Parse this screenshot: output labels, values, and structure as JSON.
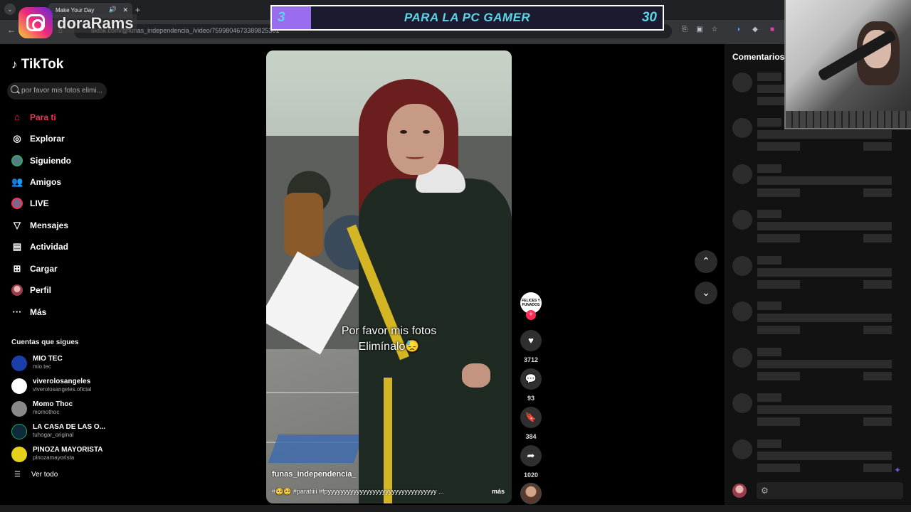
{
  "browser": {
    "tab_title": "Make Your Day",
    "url": "tiktok.com/@funas_independencia_/video/7599804673389825301"
  },
  "overlay": {
    "instagram_handle": "doraRams",
    "goal": {
      "current": "3",
      "label": "PARA LA PC GAMER",
      "target": "30",
      "progress": 0.1
    }
  },
  "tiktok": {
    "logo": "TikTok",
    "search_placeholder": "por favor mis fotos elimi...",
    "nav": [
      {
        "label": "Para ti",
        "icon": "home-icon"
      },
      {
        "label": "Explorar",
        "icon": "compass-icon"
      },
      {
        "label": "Siguiendo",
        "icon": "following-icon"
      },
      {
        "label": "Amigos",
        "icon": "friends-icon"
      },
      {
        "label": "LIVE",
        "icon": "live-icon"
      },
      {
        "label": "Mensajes",
        "icon": "messages-icon"
      },
      {
        "label": "Actividad",
        "icon": "activity-icon"
      },
      {
        "label": "Cargar",
        "icon": "upload-icon"
      },
      {
        "label": "Perfil",
        "icon": "profile-icon"
      },
      {
        "label": "Más",
        "icon": "more-icon"
      }
    ],
    "following_title": "Cuentas que sigues",
    "following": [
      {
        "name": "MIO TEC",
        "handle": "mio.tec",
        "color": "#1a3fa8"
      },
      {
        "name": "viverolosangeles",
        "handle": "viverolosangeles.oficial",
        "color": "#ffffff"
      },
      {
        "name": "Momo Thoc",
        "handle": "momothoc",
        "color": "#888888"
      },
      {
        "name": "LA CASA DE LAS O...",
        "handle": "tuhogar_original",
        "color": "#0e2a3a"
      },
      {
        "name": "PINOZA MAYORISTA",
        "handle": "pinozamayorista",
        "color": "#e5d11c"
      }
    ],
    "see_all": "Ver todo",
    "video": {
      "caption_line1": "Por favor mis fotos",
      "caption_line2": "Elimínalo😓",
      "author": "funas_independencia_",
      "description": "#🥺🥺 #paratiiii #fpyyyyyyyyyyyyyyyyyyyyyyyyyyyyyyyyyy ...",
      "more": "más"
    },
    "actions": {
      "creator_badge": "FELICES Y FUNADOS",
      "likes": "3712",
      "comments": "93",
      "saves": "384",
      "shares": "1020"
    },
    "comments_title": "Comentarios"
  }
}
